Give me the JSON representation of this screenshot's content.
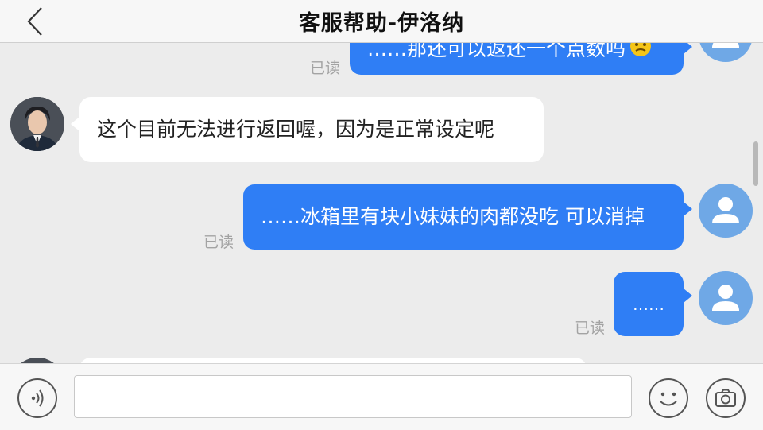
{
  "header": {
    "title": "客服帮助-伊洛纳"
  },
  "messages": [
    {
      "id": "m0",
      "from": "user",
      "text": "……那还可以返还一个点数吗",
      "status": "已读",
      "emoji": "sweating-face"
    },
    {
      "id": "m1",
      "from": "agent",
      "text": "这个目前无法进行返回喔，因为是正常设定呢"
    },
    {
      "id": "m2",
      "from": "user",
      "text": "……冰箱里有块小妹妹的肉都没吃 可以消掉",
      "status": "已读"
    },
    {
      "id": "m3",
      "from": "user",
      "text": "……",
      "status": "已读"
    }
  ],
  "input": {
    "value": "",
    "placeholder": ""
  },
  "icons": {
    "back": "chevron-left-icon",
    "voice": "voice-icon",
    "emoji": "smiley-icon",
    "camera": "camera-icon",
    "user_avatar": "user-avatar-icon"
  },
  "colors": {
    "outgoing_bubble": "#2f7ef5",
    "incoming_bubble": "#ffffff",
    "user_avatar": "#6fa8e6",
    "background": "#ececec"
  }
}
